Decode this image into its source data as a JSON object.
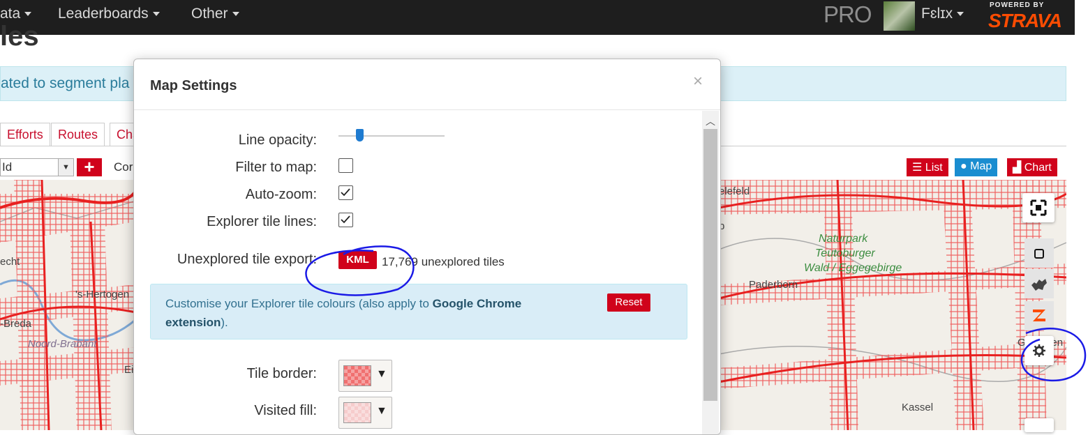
{
  "nav": {
    "items": [
      "ata",
      "Leaderboards",
      "Other"
    ],
    "pro": "PRO",
    "user": "Fɛlɪx",
    "powered_by": "POWERED BY",
    "brand": "STRAVA"
  },
  "page": {
    "title": "les",
    "banner": "ated to segment pla",
    "tabs": [
      "Efforts",
      "Routes",
      "Cha"
    ],
    "select_value": "Id",
    "con_label": "Cor",
    "view_buttons": {
      "list": "List",
      "map": "Map",
      "chart": "Chart"
    }
  },
  "map": {
    "labels": {
      "echt": "echt",
      "hertogen": "'s-Hertogen",
      "breda": "-Breda",
      "noord": "Noord-Brabant",
      "ei": "Ei",
      "ielefeld": "elefeld",
      "b": "b",
      "naturpark1": "Naturpark",
      "naturpark2": "Teutoburger",
      "naturpark3": "Wald / Eggegebirge",
      "paderborn": "Paderborn",
      "gottingen": "Göttingen",
      "kassel": "Kassel"
    }
  },
  "modal": {
    "title": "Map Settings",
    "close": "×",
    "labels": {
      "line_opacity": "Line opacity:",
      "filter_to_map": "Filter to map:",
      "auto_zoom": "Auto-zoom:",
      "explorer_tile_lines": "Explorer tile lines:",
      "unexplored_export": "Unexplored tile export:",
      "tile_border": "Tile border:",
      "visited_fill": "Visited fill:"
    },
    "line_opacity_level": 0.2,
    "filter_to_map_checked": false,
    "auto_zoom_checked": true,
    "explorer_tile_lines_checked": true,
    "kml_label": "KML",
    "unexplored_count": "17,769 unexplored tiles",
    "alert": {
      "text_before": "Customise your Explorer tile colours (also apply to ",
      "link": "Google Chrome extension",
      "text_after": ").",
      "reset": "Reset"
    },
    "dropdown_arrow": "▼"
  },
  "colors": {
    "accent_red": "#d0021b",
    "strava_orange": "#fc4c02",
    "tile_border": "#f07070",
    "visited_fill": "#f6cccc",
    "annotation_blue": "#1a1ae6"
  },
  "icons": {
    "fullscreen": "fullscreen-icon",
    "square": "square-icon",
    "heatmap": "heatmap-icon",
    "strava": "strava-icon",
    "gear": "gear-icon"
  }
}
